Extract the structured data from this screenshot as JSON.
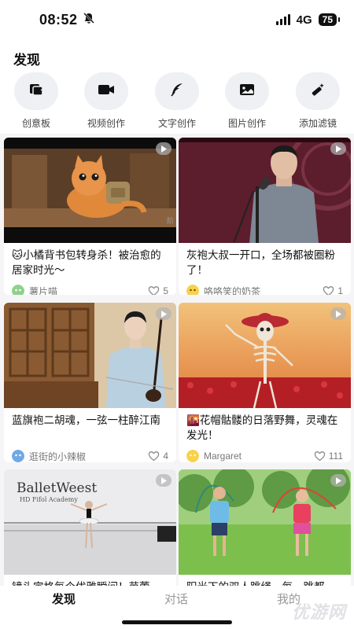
{
  "status_bar": {
    "time": "08:52",
    "network": "4G",
    "battery": "75"
  },
  "page_title": "发现",
  "tools": [
    {
      "label": "创意板",
      "icon": "creative-board-icon"
    },
    {
      "label": "视频创作",
      "icon": "video-camera-icon"
    },
    {
      "label": "文字创作",
      "icon": "quill-pen-icon"
    },
    {
      "label": "图片创作",
      "icon": "image-icon"
    },
    {
      "label": "添加滤镜",
      "icon": "magic-wand-icon"
    }
  ],
  "cards": [
    {
      "title": "🐱小橘背书包转身杀！被治愈的居家时光～",
      "author": "薯片喵",
      "likes": "5",
      "thumb_caption": "阶"
    },
    {
      "title": "灰袍大叔一开口，全场都被圈粉了！",
      "author": "咯咯笑的奶茶",
      "likes": "1"
    },
    {
      "title": "蓝旗袍二胡魂，一弦一柱醉江南",
      "author": "逛街的小辣椒",
      "likes": "4"
    },
    {
      "title": "🌇花帽骷髅的日落野舞，灵魂在发光！",
      "author": "Margaret",
      "likes": "111"
    },
    {
      "title": "镜头定格每个优雅瞬间！芭蕾",
      "thumb_text": "BalletWeest",
      "thumb_subtext": "HD Fifol Academy"
    },
    {
      "title": "阳光下的双人跳绳，每一跳都"
    }
  ],
  "bottom_nav": [
    {
      "label": "发现",
      "active": true
    },
    {
      "label": "对话",
      "active": false
    },
    {
      "label": "我的",
      "active": false
    }
  ],
  "watermark": "优游网",
  "colors": {
    "background": "#f5f5f7",
    "card": "#ffffff",
    "tool_circle": "#eef0f4",
    "text_secondary": "#777777"
  }
}
